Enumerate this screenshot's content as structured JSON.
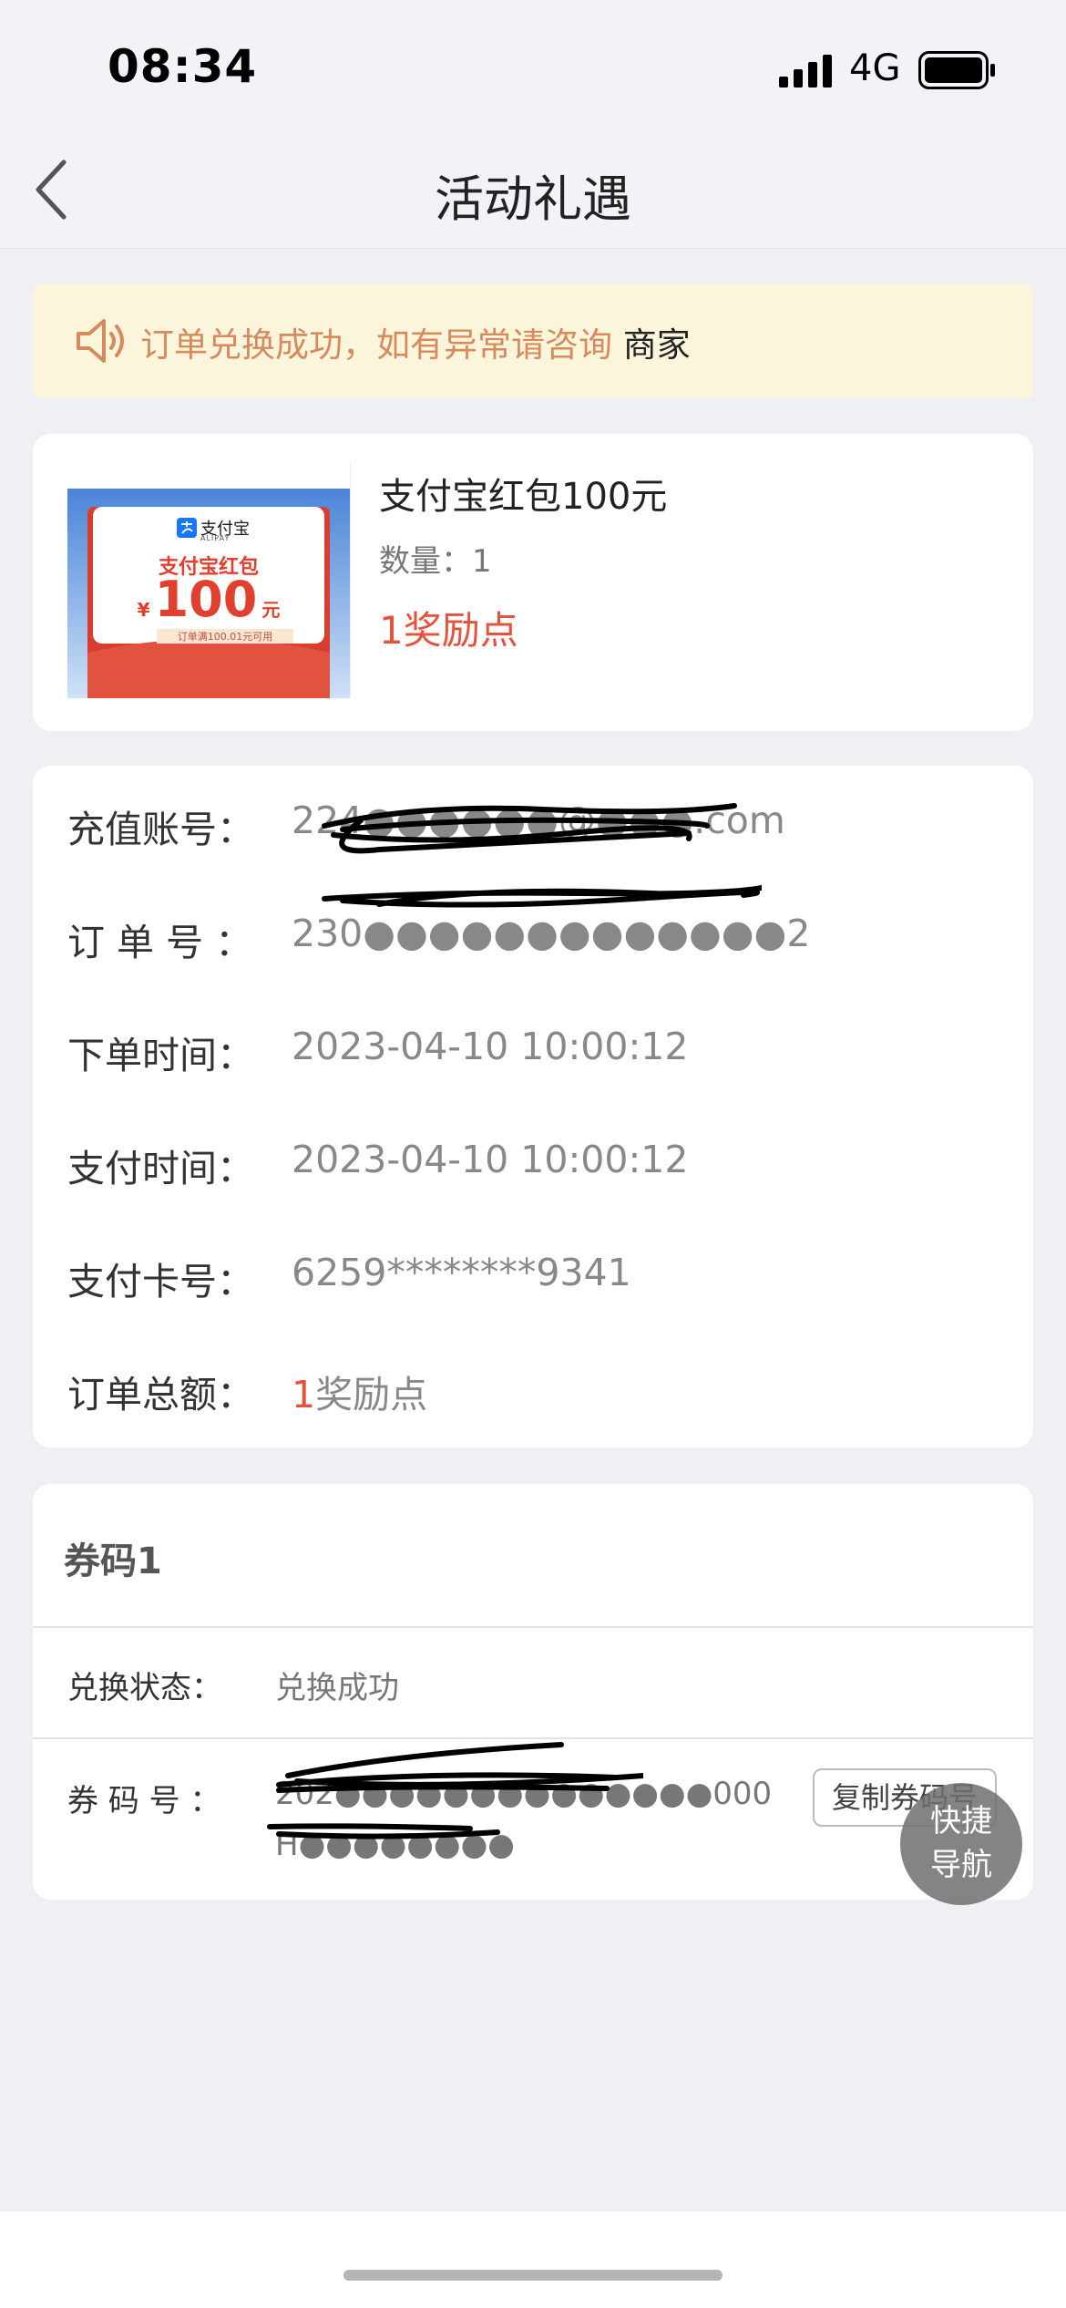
{
  "status_bar": {
    "time": "08:34",
    "network": "4G"
  },
  "nav": {
    "title": "活动礼遇"
  },
  "notice": {
    "text": "订单兑换成功，如有异常请咨询",
    "link": "商家"
  },
  "product": {
    "name": "支付宝红包100元",
    "quantity_label": "数量：1",
    "price": "1奖励点",
    "image": {
      "brand": "支付宝",
      "brand_sub": "ALIPAY",
      "title": "支付宝红包",
      "currency": "¥",
      "amount": "100",
      "unit": "元",
      "condition": "订单满100.01元可用"
    }
  },
  "details": [
    {
      "key": "充值账号：",
      "value": "224●●●●●●@●●●.com"
    },
    {
      "key": "订 单 号 ：",
      "value": "230●●●●●●●●●●●●●2"
    },
    {
      "key": "下单时间：",
      "value": "2023-04-10 10:00:12"
    },
    {
      "key": "支付时间：",
      "value": "2023-04-10 10:00:12"
    },
    {
      "key": "支付卡号：",
      "value": "6259********9341"
    }
  ],
  "total": {
    "key": "订单总额：",
    "amount": "1",
    "unit": "奖励点"
  },
  "coupon": {
    "title": "券码1",
    "status_key": "兑换状态：",
    "status_value": "兑换成功",
    "code_key": "券 码 号 ：",
    "code_line1": "202●●●●●●●●●●●●●●000",
    "code_line2": "H●●●●●●●●",
    "copy_button": "复制券码号"
  },
  "fab": {
    "line1": "快捷",
    "line2": "导航"
  },
  "colors": {
    "accent_red": "#e5533e",
    "notice_bg": "#fbf5dc",
    "notice_text": "#d78b5d"
  },
  "icons": [
    "signal-icon",
    "battery-icon",
    "back-chevron-icon",
    "speaker-icon",
    "alipay-logo-icon"
  ]
}
